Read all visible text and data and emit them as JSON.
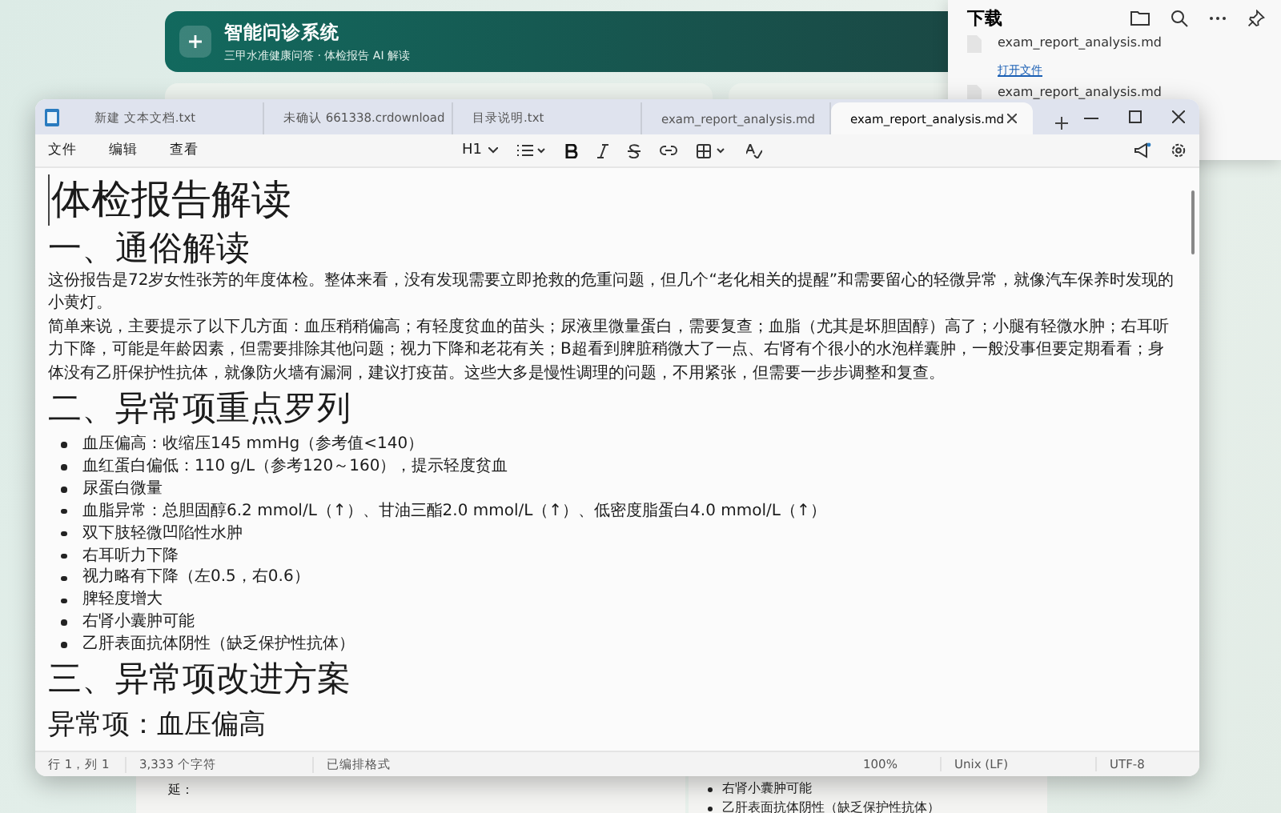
{
  "background_app": {
    "title": "智能问诊系统",
    "subtitle": "三甲水准健康问答 · 体检报告 AI 解读",
    "lower_left_text": "延：",
    "lower_right_items": [
      "右肾小囊肿可能",
      "乙肝表面抗体阴性（缺乏保护性抗体）"
    ]
  },
  "downloads": {
    "title": "下载",
    "items": [
      {
        "name": "exam_report_analysis.md",
        "link": "打开文件"
      },
      {
        "name": "exam_report_analysis.md"
      }
    ]
  },
  "notepad": {
    "tabs": [
      {
        "label": "新建 文本文档.txt",
        "selected": false
      },
      {
        "label": "未确认 661338.crdownload",
        "selected": false
      },
      {
        "label": "目录说明.txt",
        "selected": false
      },
      {
        "label": "exam_report_analysis.md",
        "selected": false
      },
      {
        "label": "exam_report_analysis.md",
        "selected": true
      }
    ],
    "menu": [
      "文件",
      "编辑",
      "查看"
    ],
    "heading_level": "H1",
    "document": [
      {
        "kind": "h1",
        "text": "体检报告解读"
      },
      {
        "kind": "h2",
        "text": "一、通俗解读"
      },
      {
        "kind": "p",
        "text": "这份报告是72岁女性张芳的年度体检。整体来看，没有发现需要立即抢救的危重问题，但几个“老化相关的提醒”和需要留心的轻微异常，就像汽车保养时发现的小黄灯。"
      },
      {
        "kind": "p",
        "text": "简单来说，主要提示了以下几方面：血压稍稍偏高；有轻度贫血的苗头；尿液里微量蛋白，需要复查；血脂（尤其是坏胆固醇）高了；小腿有轻微水肿；右耳听力下降，可能是年龄因素，但需要排除其他问题；视力下降和老花有关；B超看到脾脏稍微大了一点、右肾有个很小的水泡样囊肿，一般没事但要定期看看；身体没有乙肝保护性抗体，就像防火墙有漏洞，建议打疫苗。这些大多是慢性调理的问题，不用紧张，但需要一步步调整和复查。"
      },
      {
        "kind": "h2",
        "text": "二、异常项重点罗列"
      },
      {
        "kind": "li",
        "text": "血压偏高：收缩压145 mmHg（参考值<140）"
      },
      {
        "kind": "li",
        "text": "血红蛋白偏低：110 g/L（参考120～160），提示轻度贫血"
      },
      {
        "kind": "li",
        "text": "尿蛋白微量"
      },
      {
        "kind": "li",
        "text": "血脂异常：总胆固醇6.2 mmol/L（↑）、甘油三酯2.0 mmol/L（↑）、低密度脂蛋白4.0 mmol/L（↑）"
      },
      {
        "kind": "li",
        "text": "双下肢轻微凹陷性水肿"
      },
      {
        "kind": "li",
        "text": "右耳听力下降"
      },
      {
        "kind": "li",
        "text": "视力略有下降（左0.5，右0.6）"
      },
      {
        "kind": "li",
        "text": "脾轻度增大"
      },
      {
        "kind": "li",
        "text": "右肾小囊肿可能"
      },
      {
        "kind": "li",
        "text": "乙肝表面抗体阴性（缺乏保护性抗体）"
      },
      {
        "kind": "h2",
        "text": "三、异常项改进方案"
      },
      {
        "kind": "h3",
        "text": "异常项：血压偏高"
      }
    ],
    "status_bar": [
      "行 1，列 1",
      "3,333 个字符",
      "已编排格式",
      "100%",
      "Unix (LF)",
      "UTF-8"
    ]
  }
}
